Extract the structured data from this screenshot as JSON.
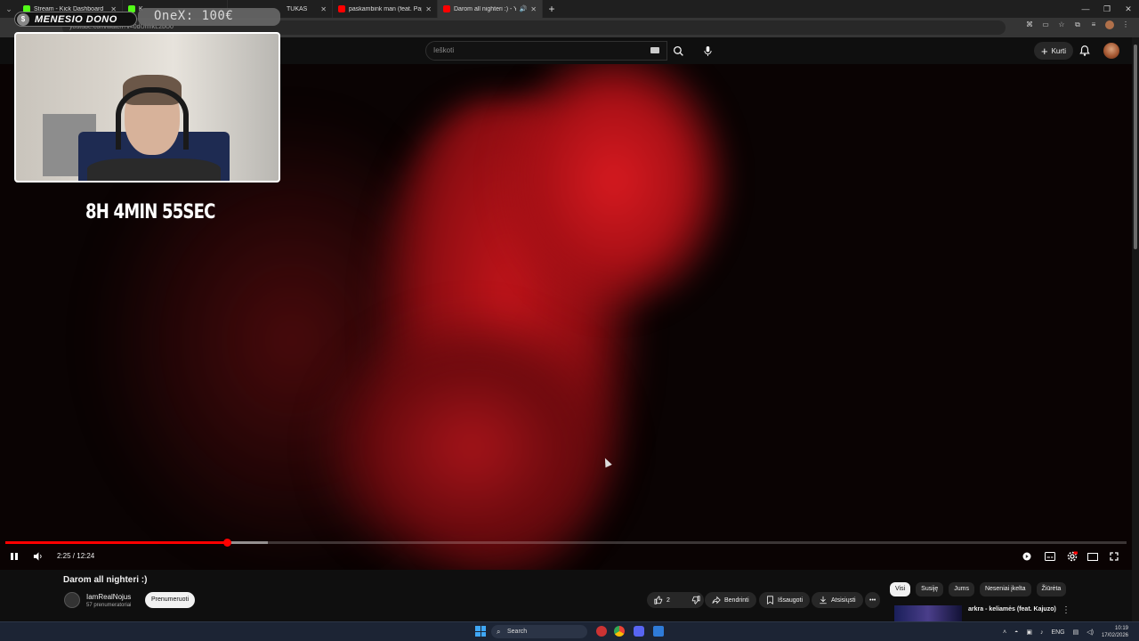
{
  "browser": {
    "tabs": [
      {
        "title": "Stream - Kick Dashboard",
        "favicon_color": "#53fc18",
        "active": false
      },
      {
        "title": "K",
        "favicon_color": "#53fc18",
        "active": false
      },
      {
        "title": "TUKAS",
        "favicon_color": "#888888",
        "active": false
      },
      {
        "title": "paskambink man (feat. Papi &",
        "favicon_color": "#ff0000",
        "active": false
      },
      {
        "title": "Darom all nighteri :) - YouTu",
        "favicon_color": "#ff0000",
        "active": true,
        "audio": true
      }
    ],
    "url": "youtube.com/watch?v=0dUhfrkL2bU0",
    "window_controls": [
      "—",
      "❐",
      "✕"
    ]
  },
  "youtube": {
    "search_placeholder": "Ieškoti",
    "create_label": "Kurti"
  },
  "overlays": {
    "dono_label": "MENESIO DONO",
    "dono_coin": "$",
    "onex_label": "OneX: 100€",
    "timer": "8H 4MIN 55SEC"
  },
  "player": {
    "time": "2:25 / 12:24",
    "played_fraction": 0.198,
    "buffered_fraction": 0.234
  },
  "video": {
    "title": "Darom all nighteri :)",
    "channel": "IamRealNojus",
    "subscribers": "57 prenumeratoriai",
    "subscribe_label": "Prenumeruoti",
    "likes": "2",
    "share_label": "Bendrinti",
    "save_label": "Išsaugoti",
    "download_label": "Atsisiųsti",
    "more_label": "•••"
  },
  "sidebar": {
    "chips": [
      "Visi",
      "Susiję",
      "Jums",
      "Neseniai įkelta",
      "Žiūrėta"
    ],
    "recommendation_title": "arkra - keliamės (feat. Kajuzo)"
  },
  "taskbar": {
    "search_label": "Search",
    "language": "ENG",
    "time": "10:19",
    "date": "17/02/2026"
  }
}
